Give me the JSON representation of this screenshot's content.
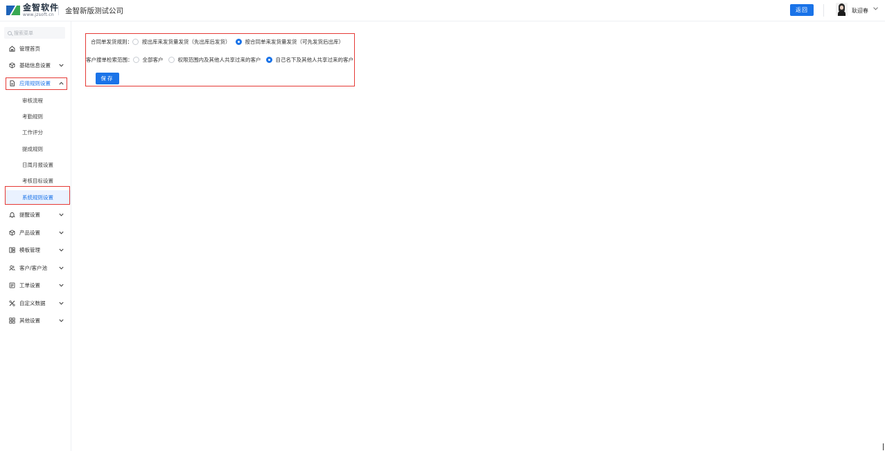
{
  "header": {
    "logo_cn": "金智软件",
    "logo_en": "www.jzsoft.cn",
    "company": "金智新版测试公司",
    "back_label": "返回",
    "user_name": "耿迎春",
    "user_caret_icon": "chevron-down-icon"
  },
  "sidebar": {
    "search_placeholder": "搜索菜单",
    "items": [
      {
        "label": "管理首页",
        "icon": "home-icon",
        "has_caret": false
      },
      {
        "label": "基础信息设置",
        "icon": "cube-icon",
        "has_caret": true,
        "caret": "⌄"
      },
      {
        "label": "应用规则设置",
        "icon": "document-icon",
        "has_caret": true,
        "caret": "⌃",
        "active": true
      },
      {
        "label": "提醒设置",
        "icon": "bell-icon",
        "has_caret": true,
        "caret": "⌄"
      },
      {
        "label": "产品设置",
        "icon": "cube-icon",
        "has_caret": true,
        "caret": "⌄"
      },
      {
        "label": "模板管理",
        "icon": "template-icon",
        "has_caret": true,
        "caret": "⌄"
      },
      {
        "label": "客户/客户池",
        "icon": "customer-icon",
        "has_caret": true,
        "caret": "⌄"
      },
      {
        "label": "工单设置",
        "icon": "ticket-icon",
        "has_caret": true,
        "caret": "⌄"
      },
      {
        "label": "自定义数据",
        "icon": "tools-icon",
        "has_caret": true,
        "caret": "⌄"
      },
      {
        "label": "其他设置",
        "icon": "grid-icon",
        "has_caret": true,
        "caret": "⌄"
      }
    ],
    "sub_items": [
      {
        "label": "审核流程"
      },
      {
        "label": "考勤规则"
      },
      {
        "label": "工作评分"
      },
      {
        "label": "提成规则"
      },
      {
        "label": "日周月报设置"
      },
      {
        "label": "考核目标设置"
      },
      {
        "label": "系统规则设置",
        "selected": true
      }
    ]
  },
  "form": {
    "row1": {
      "label": "合同单发货规则：",
      "options": [
        {
          "label": "按出库来发货量发货（先出库后发货）",
          "checked": false
        },
        {
          "label": "按合同单来发货量发货（可先发货后出库）",
          "checked": true
        }
      ]
    },
    "row2": {
      "label": "客户搜单检索范围：",
      "options": [
        {
          "label": "全部客户",
          "checked": false
        },
        {
          "label": "权限范围内及其他人共享过来的客户",
          "checked": false
        },
        {
          "label": "自己名下及其他人共享过来的客户",
          "checked": true
        }
      ]
    },
    "save_label": "保存"
  },
  "colors": {
    "accent": "#1a73e8",
    "highlight_border": "#e53935",
    "selected_bg": "#eaf2ff"
  }
}
